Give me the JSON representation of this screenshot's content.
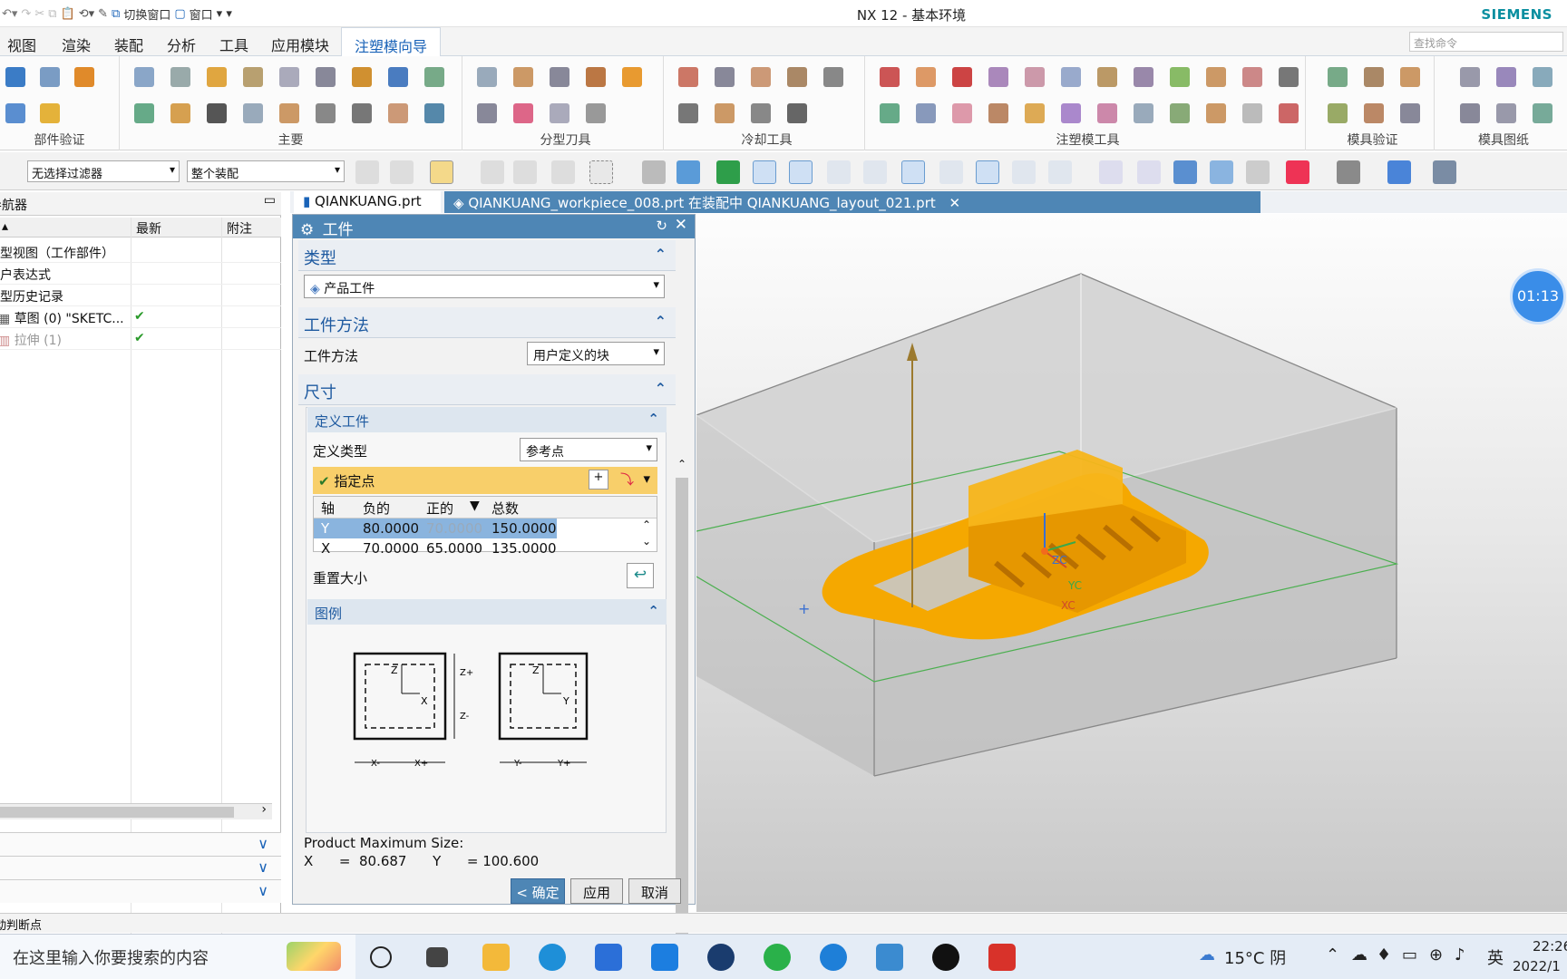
{
  "window": {
    "title": "NX 12 - 基本环境",
    "brand": "SIEMENS"
  },
  "quick_access": {
    "switch_window": "切换窗口",
    "window_menu": "窗口"
  },
  "menu": {
    "items": [
      "视图",
      "渲染",
      "装配",
      "分析",
      "工具",
      "应用模块"
    ],
    "active": "注塑模向导"
  },
  "search": {
    "placeholder": "查找命令"
  },
  "ribbon": {
    "groups": [
      "部件验证",
      "主要",
      "分型刀具",
      "冷却工具",
      "注塑模工具",
      "模具验证",
      "模具图纸"
    ]
  },
  "toolbar": {
    "filter": "无选择过滤器",
    "scope": "整个装配"
  },
  "navigator": {
    "header": "导航器",
    "columns": [
      "",
      "最新",
      "附注"
    ],
    "rows": [
      {
        "label": "模型视图（工作部件）",
        "check": ""
      },
      {
        "label": "用户表达式",
        "check": ""
      },
      {
        "label": "模型历史记录",
        "check": ""
      },
      {
        "label": "草图 (0) \"SKETC...",
        "check": "✔"
      },
      {
        "label": "拉伸 (1)",
        "check": "✔"
      }
    ]
  },
  "tabs": [
    {
      "label": "QIANKUANG.prt"
    },
    {
      "label": "QIANKUANG_workpiece_008.prt 在装配中 QIANKUANG_layout_021.prt"
    }
  ],
  "dialog": {
    "title": "工件",
    "sec_type": "类型",
    "type_value": "产品工件",
    "sec_method": "工件方法",
    "method_label": "工件方法",
    "method_value": "用户定义的块",
    "sec_size": "尺寸",
    "define_sub": "定义工件",
    "define_type_label": "定义类型",
    "define_type_value": "参考点",
    "point_label": "指定点",
    "table": {
      "headers": [
        "轴",
        "负的",
        "正的",
        "总数"
      ],
      "rows": [
        {
          "axis": "Y",
          "neg": "80.0000",
          "pos": "70.0000",
          "total": "150.0000"
        },
        {
          "axis": "X",
          "neg": "70.0000",
          "pos": "65.0000",
          "total": "135.0000"
        }
      ]
    },
    "resize_label": "重置大小",
    "legend_sub": "图例",
    "legend": {
      "zplus": "Z+",
      "zminus": "Z-",
      "xminus": "X-",
      "xplus": "X+",
      "yminus": "Y-",
      "yplus": "Y+",
      "z": "Z",
      "x": "X",
      "y": "Y"
    },
    "product_max_label": "Product Maximum Size:",
    "product_max_values": "X      =  80.687      Y      = 100.600",
    "ok": "< 确定 >",
    "apply": "应用",
    "cancel": "取消"
  },
  "viewport": {
    "timer": "01:13",
    "axes": {
      "zc": "ZC",
      "yc": "YC",
      "xc": "XC"
    },
    "part_color": "#f5a800"
  },
  "status": {
    "text": "动判断点"
  },
  "taskbar": {
    "search_placeholder": "在这里输入你要搜索的内容",
    "weather": "15°C 阴",
    "lang": "英",
    "time": "22:26",
    "date": "2022/1"
  }
}
